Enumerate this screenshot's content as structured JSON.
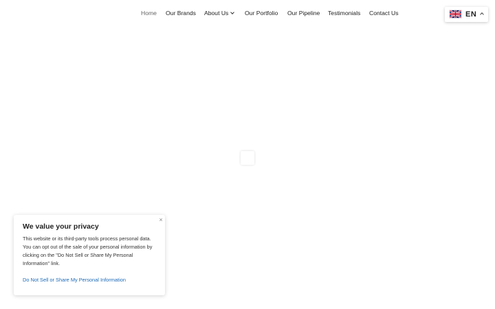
{
  "nav": {
    "items": [
      {
        "label": "Home"
      },
      {
        "label": "Our Brands"
      },
      {
        "label": "About Us"
      },
      {
        "label": "Our Portfolio"
      },
      {
        "label": "Our Pipeline"
      },
      {
        "label": "Testimonials"
      },
      {
        "label": "Contact Us"
      }
    ]
  },
  "language": {
    "code": "EN",
    "flag_icon": "uk-flag-icon"
  },
  "consent": {
    "title": "We value your privacy",
    "body": "This website or its third-party tools process personal data. You can opt out of the sale of your personal information by clicking on the \"Do Not Sell or Share My Personal Information\" link.",
    "link": "Do Not Sell or Share My Personal Information",
    "close_symbol": "×"
  },
  "colors": {
    "link": "#1e6bb8",
    "home": "#666666"
  }
}
